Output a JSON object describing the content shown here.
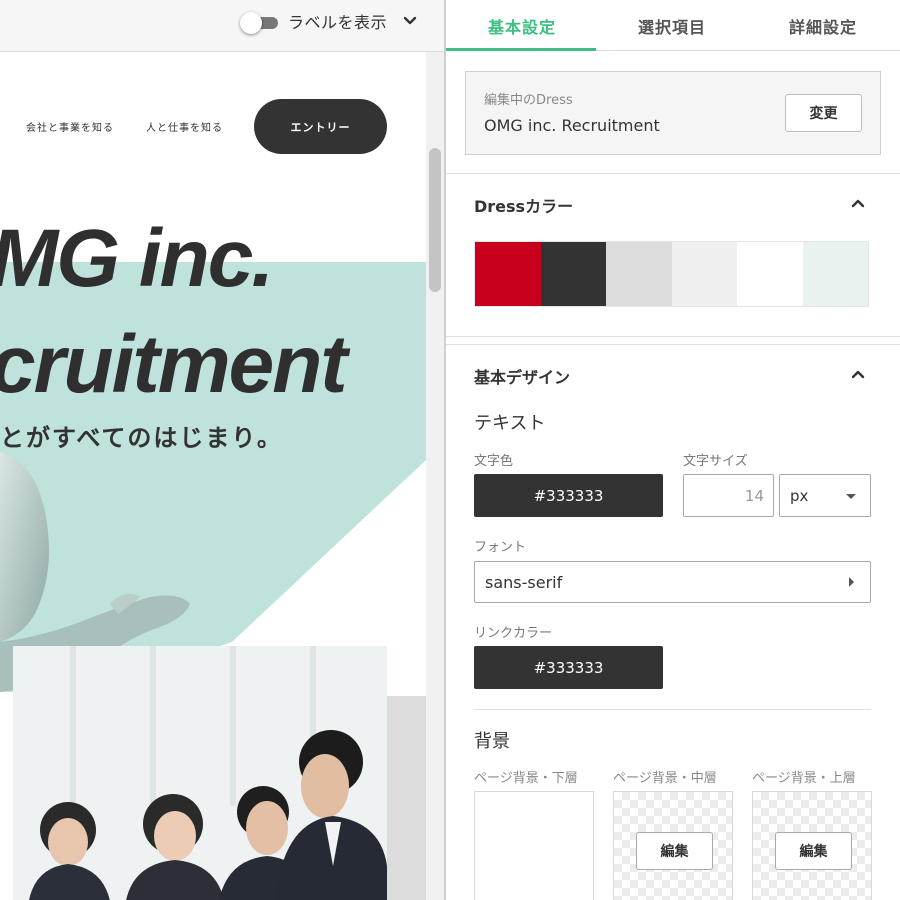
{
  "preview": {
    "toolbar": {
      "label_toggle_text": "ラベルを表示"
    },
    "site": {
      "nav": [
        "会社と事業を知る",
        "人と仕事を知る"
      ],
      "entry_button": "エントリー",
      "hero_line1": "MG inc.",
      "hero_line2": "cruitment",
      "hero_sub": "とがすべてのはじまり。"
    }
  },
  "settings": {
    "tabs": [
      {
        "label": "基本設定",
        "active": true
      },
      {
        "label": "選択項目",
        "active": false
      },
      {
        "label": "詳細設定",
        "active": false
      }
    ],
    "dress": {
      "caption": "編集中のDress",
      "name": "OMG inc. Recruitment",
      "change_button": "変更"
    },
    "dress_color": {
      "title": "Dressカラー",
      "swatches": [
        "#c8001e",
        "#333333",
        "#dcdcdc",
        "#efefef",
        "#ffffff",
        "#eaf2f0"
      ]
    },
    "basic_design": {
      "title": "基本デザイン",
      "text_section": "テキスト",
      "text_color_label": "文字色",
      "text_color_value": "#333333",
      "font_size_label": "文字サイズ",
      "font_size_value": "14",
      "font_size_unit": "px",
      "font_label": "フォント",
      "font_value": "sans-serif",
      "link_color_label": "リンクカラー",
      "link_color_value": "#333333",
      "background_section": "背景",
      "bg_lower_label": "ページ背景・下層",
      "bg_middle_label": "ページ背景・中層",
      "bg_upper_label": "ページ背景・上層",
      "edit_button": "編集"
    },
    "accent_color": "#3cbf81"
  }
}
